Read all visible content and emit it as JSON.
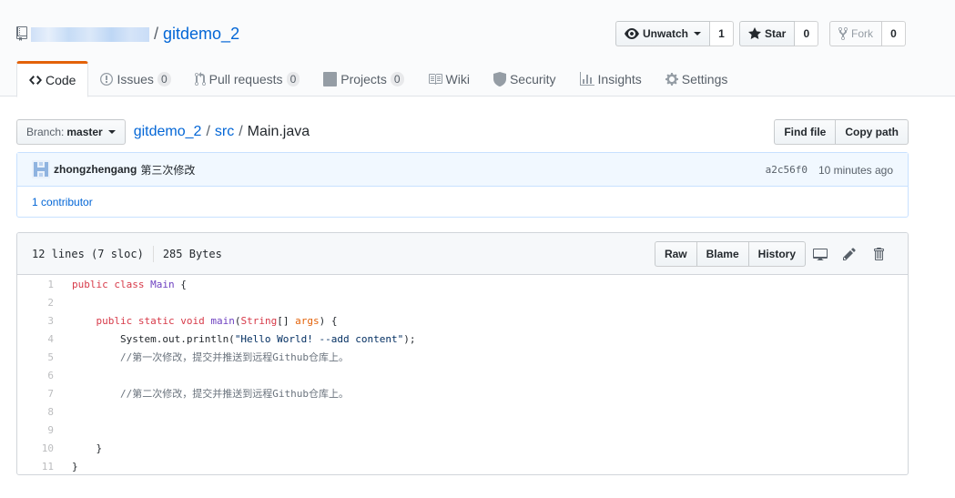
{
  "repo": {
    "owner": "",
    "separator": "/",
    "name": "gitdemo_2"
  },
  "actions": {
    "unwatch_label": "Unwatch",
    "watch_count": "1",
    "star_label": "Star",
    "star_count": "0",
    "fork_label": "Fork",
    "fork_count": "0"
  },
  "tabs": [
    {
      "label": "Code",
      "icon": "code-icon",
      "selected": true
    },
    {
      "label": "Issues",
      "count": "0",
      "icon": "issue-icon"
    },
    {
      "label": "Pull requests",
      "count": "0",
      "icon": "pull-request-icon"
    },
    {
      "label": "Projects",
      "count": "0",
      "icon": "project-icon"
    },
    {
      "label": "Wiki",
      "icon": "book-icon"
    },
    {
      "label": "Security",
      "icon": "shield-icon"
    },
    {
      "label": "Insights",
      "icon": "graph-icon"
    },
    {
      "label": "Settings",
      "icon": "gear-icon"
    }
  ],
  "file_nav": {
    "branch_label": "Branch:",
    "branch_value": "master",
    "breadcrumb": [
      "gitdemo_2",
      "src",
      "Main.java"
    ],
    "sep": "/",
    "find_file": "Find file",
    "copy_path": "Copy path"
  },
  "commit": {
    "author": "zhongzhengang",
    "message": "第三次修改",
    "sha": "a2c56f0",
    "time": "10 minutes ago",
    "contributors_count": "1",
    "contributors_label": "contributor"
  },
  "file": {
    "lines_info": "12 lines (7 sloc)",
    "size": "285 Bytes",
    "raw": "Raw",
    "blame": "Blame",
    "history": "History"
  },
  "code": [
    {
      "n": "1",
      "text": "public class Main {"
    },
    {
      "n": "2",
      "text": ""
    },
    {
      "n": "3",
      "text": "    public static void main(String[] args) {"
    },
    {
      "n": "4",
      "text": "        System.out.println(\"Hello World! --add content\");"
    },
    {
      "n": "5",
      "text": "        //第一次修改，提交并推送到远程Github仓库上。"
    },
    {
      "n": "6",
      "text": ""
    },
    {
      "n": "7",
      "text": "        //第二次修改，提交并推送到远程Github仓库上。"
    },
    {
      "n": "8",
      "text": ""
    },
    {
      "n": "9",
      "text": ""
    },
    {
      "n": "10",
      "text": "    }"
    },
    {
      "n": "11",
      "text": "}"
    }
  ],
  "colors": {
    "link": "#0366d6",
    "selected_tab_accent": "#e36209",
    "keyword": "#d73a49",
    "entity": "#6f42c1"
  }
}
